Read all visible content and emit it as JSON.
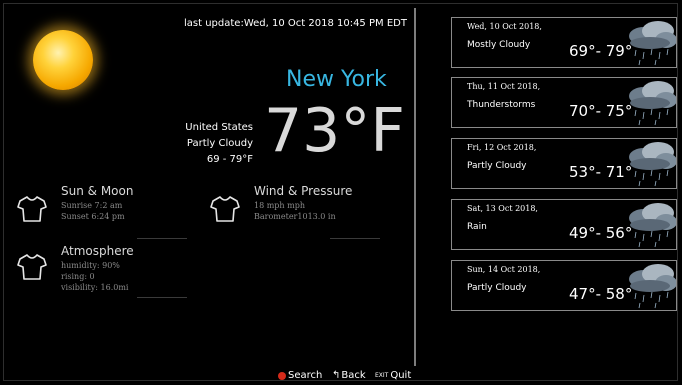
{
  "header": {
    "update": "last update:Wed, 10 Oct 2018 10:45 PM EDT"
  },
  "current": {
    "city": "New York",
    "temp": "73°F",
    "country": "United States",
    "condition": "Partly Cloudy",
    "range": "69 - 79°F"
  },
  "sections": {
    "sun_moon": {
      "title": "Sun & Moon",
      "sunrise": "Sunrise 7:2 am",
      "sunset": "Sunset 6:24 pm"
    },
    "wind": {
      "title": "Wind & Pressure",
      "speed": "18 mph mph",
      "barometer": "Barometer1013.0 in"
    },
    "atmosphere": {
      "title": "Atmosphere",
      "humidity": "humidity: 90%",
      "rising": "rising: 0",
      "visibility": "visibility: 16.0mi"
    }
  },
  "forecast": [
    {
      "date": "Wed, 10 Oct 2018,",
      "condition": "Mostly Cloudy",
      "temps": "69°- 79°"
    },
    {
      "date": "Thu, 11 Oct 2018,",
      "condition": "Thunderstorms",
      "temps": "70°- 75°"
    },
    {
      "date": "Fri, 12 Oct 2018,",
      "condition": "Partly Cloudy",
      "temps": "53°- 71°"
    },
    {
      "date": "Sat, 13 Oct 2018,",
      "condition": "Rain",
      "temps": "49°- 56°"
    },
    {
      "date": "Sun, 14 Oct 2018,",
      "condition": "Partly Cloudy",
      "temps": "47°- 58°"
    }
  ],
  "footer": {
    "search": "Search",
    "back": "Back",
    "exit_key": "EXIT",
    "quit": "Quit"
  },
  "colors": {
    "city": "#38b7e2",
    "search_key": "#d42a1a"
  }
}
